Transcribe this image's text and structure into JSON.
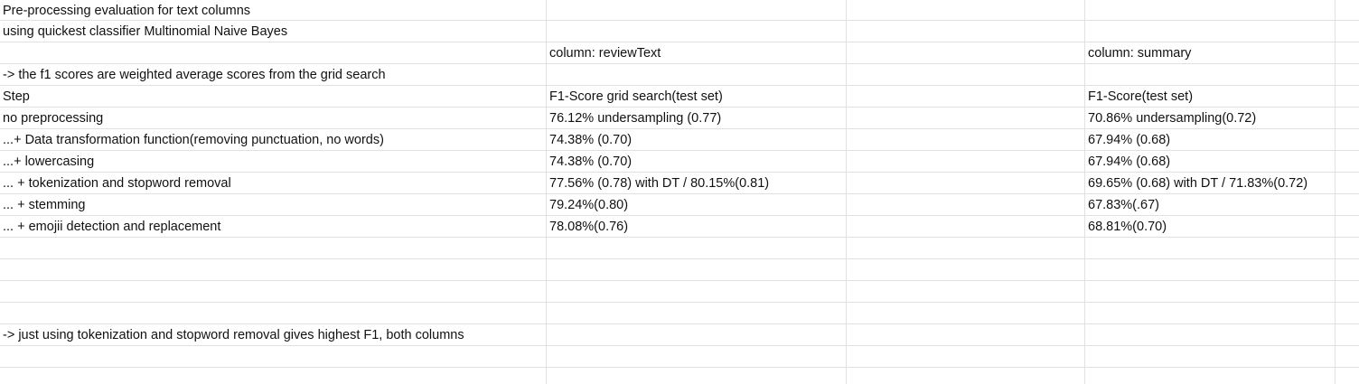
{
  "sheet": {
    "header_lines": [
      "Pre-processing evaluation for text columns",
      "using quickest classifier Multinomial Naive Bayes"
    ],
    "column_review_label": "column: reviewText",
    "column_summary_label": "column: summary",
    "note_weighted": " -> the f1 scores are weighted average scores from the grid search",
    "table_headers": {
      "step": "Step",
      "review": "F1-Score grid search(test set)",
      "summary": "F1-Score(test set)"
    },
    "rows": [
      {
        "step": "no preprocessing",
        "review": "76.12% undersampling (0.77)",
        "summary": "70.86% undersampling(0.72)"
      },
      {
        "step": "...+ Data transformation function(removing punctuation, no words)",
        "review": "74.38% (0.70)",
        "summary": "67.94% (0.68)"
      },
      {
        "step": "...+ lowercasing",
        "review": "74.38% (0.70)",
        "summary": "67.94% (0.68)"
      },
      {
        "step": "... + tokenization and stopword removal",
        "review": "77.56% (0.78) with DT / 80.15%(0.81)",
        "summary": "69.65% (0.68) with DT / 71.83%(0.72)"
      },
      {
        "step": "... + stemming",
        "review": "79.24%(0.80)",
        "summary": "67.83%(.67)"
      },
      {
        "step": "... + emojii detection and replacement",
        "review": "78.08%(0.76)",
        "summary": "68.81%(0.70)"
      }
    ],
    "conclusion": " -> just using tokenization and stopword removal gives highest F1, both columns"
  }
}
